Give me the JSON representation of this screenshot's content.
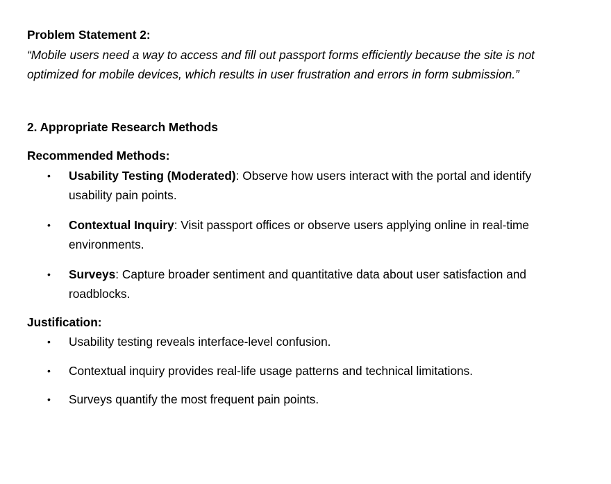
{
  "problem": {
    "title": "Problem Statement 2:",
    "quote": "“Mobile users need a way to access and fill out passport forms efficiently because the site is not optimized for mobile devices, which results in user frustration and errors in form submission.”"
  },
  "section": {
    "heading": "2. Appropriate Research Methods",
    "methods_heading": "Recommended Methods:",
    "methods": [
      {
        "term": "Usability Testing (Moderated)",
        "desc": ": Observe how users interact with the portal and identify usability pain points."
      },
      {
        "term": "Contextual Inquiry",
        "desc": ": Visit passport offices or observe users applying online in real-time environments."
      },
      {
        "term": "Surveys",
        "desc": ": Capture broader sentiment and quantitative data about user satisfaction and roadblocks."
      }
    ],
    "justification_heading": "Justification:",
    "justifications": [
      "Usability testing reveals interface-level confusion.",
      "Contextual inquiry provides real-life usage patterns and technical limitations.",
      "Surveys quantify the most frequent pain points."
    ],
    "bullet_char": "•"
  }
}
